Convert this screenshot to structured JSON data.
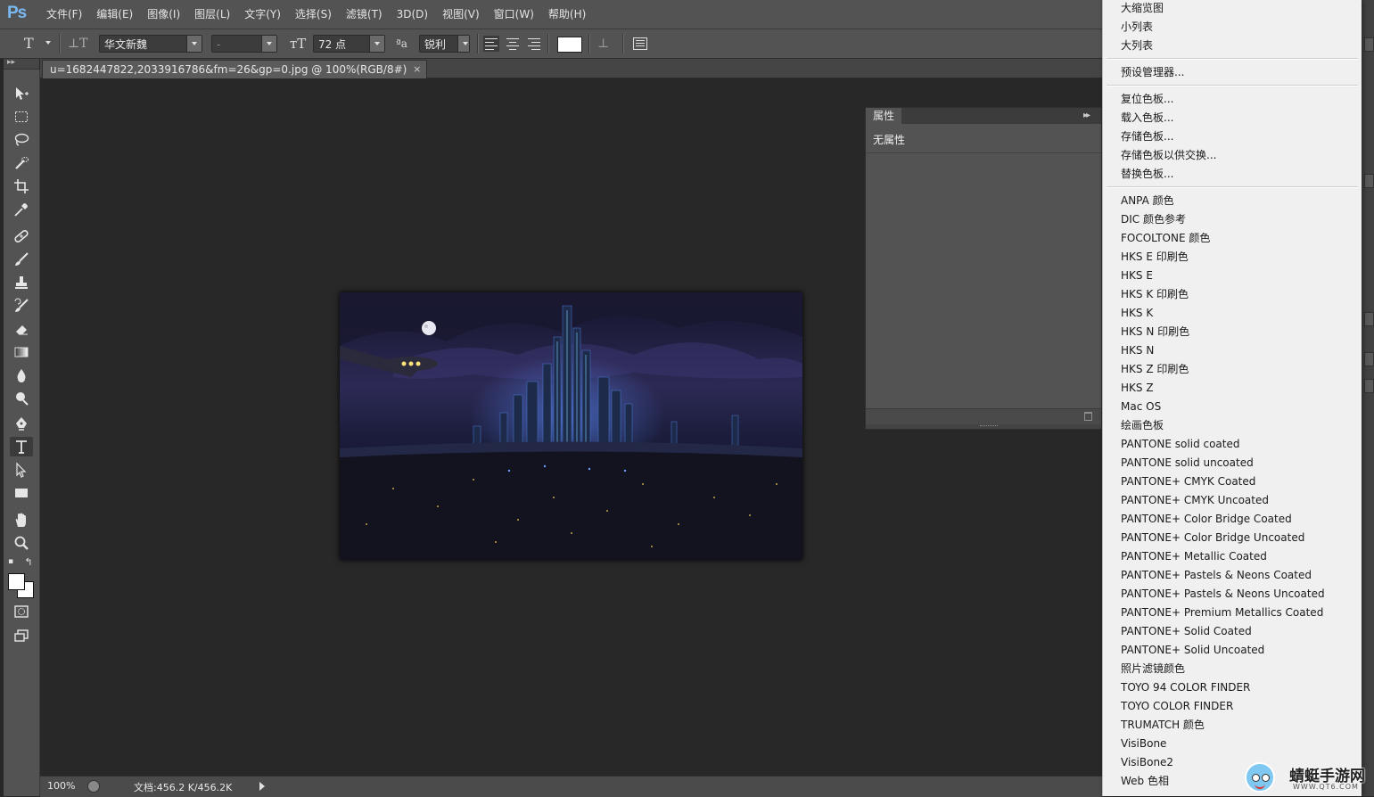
{
  "app": {
    "logo": "Ps",
    "menu": [
      "文件(F)",
      "编辑(E)",
      "图像(I)",
      "图层(L)",
      "文字(Y)",
      "选择(S)",
      "滤镜(T)",
      "3D(D)",
      "视图(V)",
      "窗口(W)",
      "帮助(H)"
    ]
  },
  "options": {
    "font_family": "华文新魏",
    "font_style": "-",
    "font_size": "72 点",
    "antialias": "锐利",
    "text_color": "#ffffff"
  },
  "document": {
    "tab_title": "u=1682447822,2033916786&fm=26&gp=0.jpg @ 100%(RGB/8#)",
    "close_glyph": "×"
  },
  "status": {
    "zoom": "100%",
    "doc_size": "文档:456.2 K/456.2K"
  },
  "properties_panel": {
    "tab_label": "属性",
    "expand_glyph": "▸▸",
    "empty_text": "无属性"
  },
  "flyout_menu": {
    "view_options": [
      "大缩览图",
      "小列表",
      "大列表"
    ],
    "preset_manager": "预设管理器...",
    "swatch_actions": [
      "复位色板...",
      "载入色板...",
      "存储色板...",
      "存储色板以供交换...",
      "替换色板..."
    ],
    "libraries": [
      "ANPA 颜色",
      "DIC 颜色参考",
      "FOCOLTONE 颜色",
      "HKS E 印刷色",
      "HKS E",
      "HKS K 印刷色",
      "HKS K",
      "HKS N 印刷色",
      "HKS N",
      "HKS Z 印刷色",
      "HKS Z",
      "Mac OS",
      "绘画色板",
      "PANTONE solid coated",
      "PANTONE solid uncoated",
      "PANTONE+ CMYK Coated",
      "PANTONE+ CMYK Uncoated",
      "PANTONE+ Color Bridge Coated",
      "PANTONE+ Color Bridge Uncoated",
      "PANTONE+ Metallic Coated",
      "PANTONE+ Pastels & Neons Coated",
      "PANTONE+ Pastels & Neons Uncoated",
      "PANTONE+ Premium Metallics Coated",
      "PANTONE+ Solid Coated",
      "PANTONE+ Solid Uncoated",
      "照片滤镜颜色",
      "TOYO 94 COLOR FINDER",
      "TOYO COLOR FINDER",
      "TRUMATCH 颜色",
      "VisiBone",
      "VisiBone2",
      "Web 色相"
    ]
  },
  "watermark": {
    "title": "蜻蜓手游网",
    "url": "WWW.QT6.COM"
  },
  "colors": {
    "foreground": "#ffffff",
    "background": "#ffffff",
    "ui_panel": "#535353",
    "ui_canvas": "#282828"
  }
}
